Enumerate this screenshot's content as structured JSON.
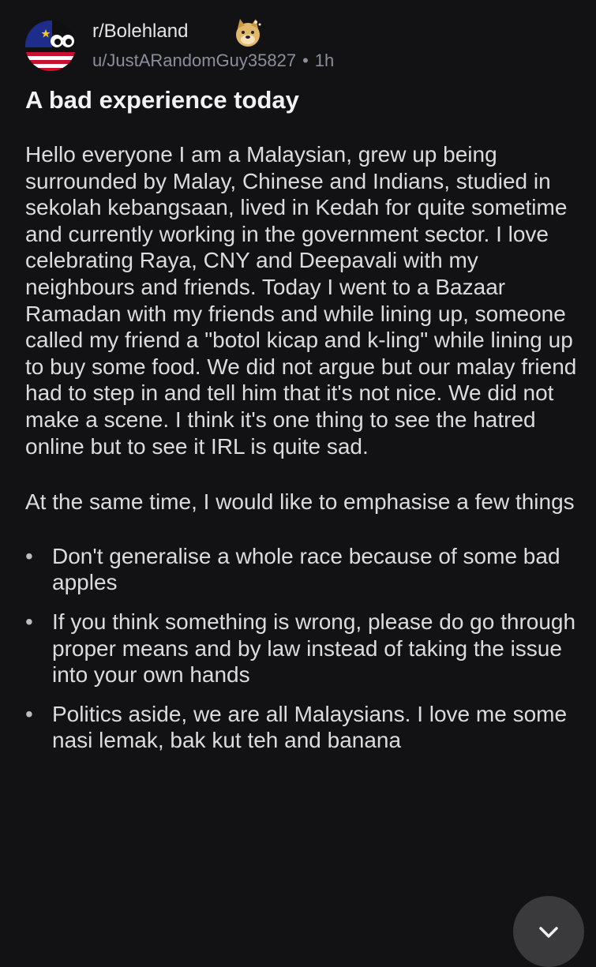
{
  "header": {
    "subreddit": "r/Bolehland",
    "username": "u/JustARandomGuy35827",
    "separator": "•",
    "time_ago": "1h",
    "avatar_icon": "subreddit-avatar-icon",
    "flair_icon": "doge-icon"
  },
  "post": {
    "title": "A bad experience today",
    "paragraphs": [
      "Hello everyone I am a Malaysian, grew up being surrounded by Malay, Chinese and Indians, studied in sekolah kebangsaan, lived in Kedah for quite sometime and currently working in the government sector. I love celebrating Raya, CNY and Deepavali with my neighbours and friends. Today I went to a Bazaar Ramadan with my friends and while lining up, someone called my friend a \"botol kicap and k-ling\" while lining up to buy some food. We did not argue but our malay friend had to step in and tell him that it's not nice. We did not make a scene. I think it's one thing to see the hatred online but to see it IRL is quite sad.",
      "At the same time, I would like to emphasise a few things"
    ],
    "bullet_glyph": "•",
    "bullets": [
      "Don't generalise a whole race because of some bad apples",
      "If you think something is wrong, please do go through proper means and by law instead of taking the issue into your own hands",
      "Politics aside, we are all Malaysians. I love me some nasi lemak, bak kut teh and banana"
    ]
  },
  "fab": {
    "icon": "close-icon"
  },
  "colors": {
    "background": "#121214",
    "text": "#dcdcdc",
    "meta": "#8a8f99",
    "fab": "#3a3a3d"
  }
}
